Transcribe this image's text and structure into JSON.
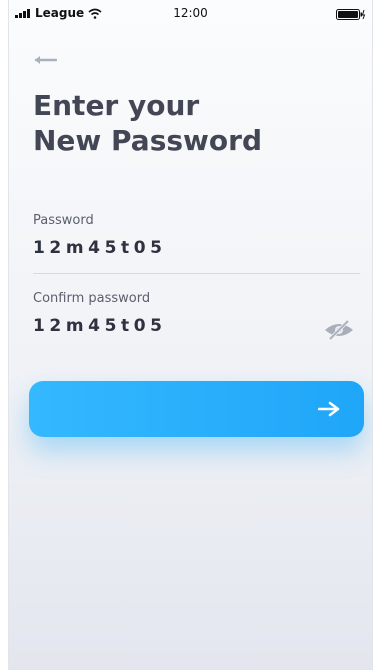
{
  "status_bar": {
    "carrier": "League",
    "time": "12:00"
  },
  "heading": {
    "line1": "Enter your",
    "line2": "New Password"
  },
  "password_field": {
    "label": "Password",
    "value": "12m45t05"
  },
  "confirm_field": {
    "label": "Confirm password",
    "value": "12m45t05"
  },
  "icons": {
    "back": "arrow-left-icon",
    "visibility": "eye-off-icon",
    "submit": "arrow-right-icon"
  },
  "colors": {
    "accent": "#22aaf9",
    "heading": "#434654",
    "muted": "#a9aebb"
  }
}
